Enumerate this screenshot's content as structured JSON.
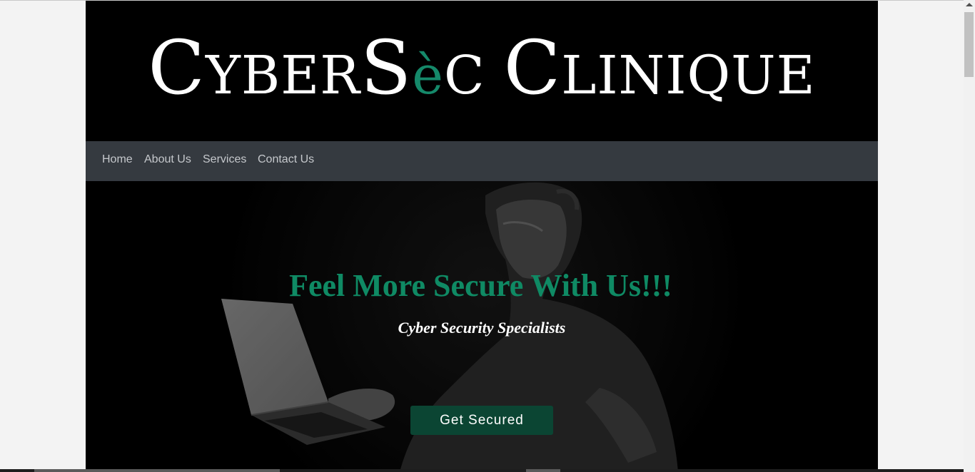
{
  "logo": {
    "part1_big": "C",
    "part1_small": "YBER",
    "part2_big": "S",
    "part2_accent": "è",
    "part2_small": "C",
    "part3_big": "C",
    "part3_small": "LINIQUE",
    "accent_color": "#15896a"
  },
  "nav": {
    "items": [
      {
        "label": "Home"
      },
      {
        "label": "About Us"
      },
      {
        "label": "Services"
      },
      {
        "label": "Contact Us"
      }
    ]
  },
  "hero": {
    "title": "Feel More Secure With Us!!!",
    "subtitle": "Cyber Security Specialists",
    "cta_label": "Get Secured",
    "title_color": "#0f8a64",
    "cta_color": "#0b4533"
  }
}
